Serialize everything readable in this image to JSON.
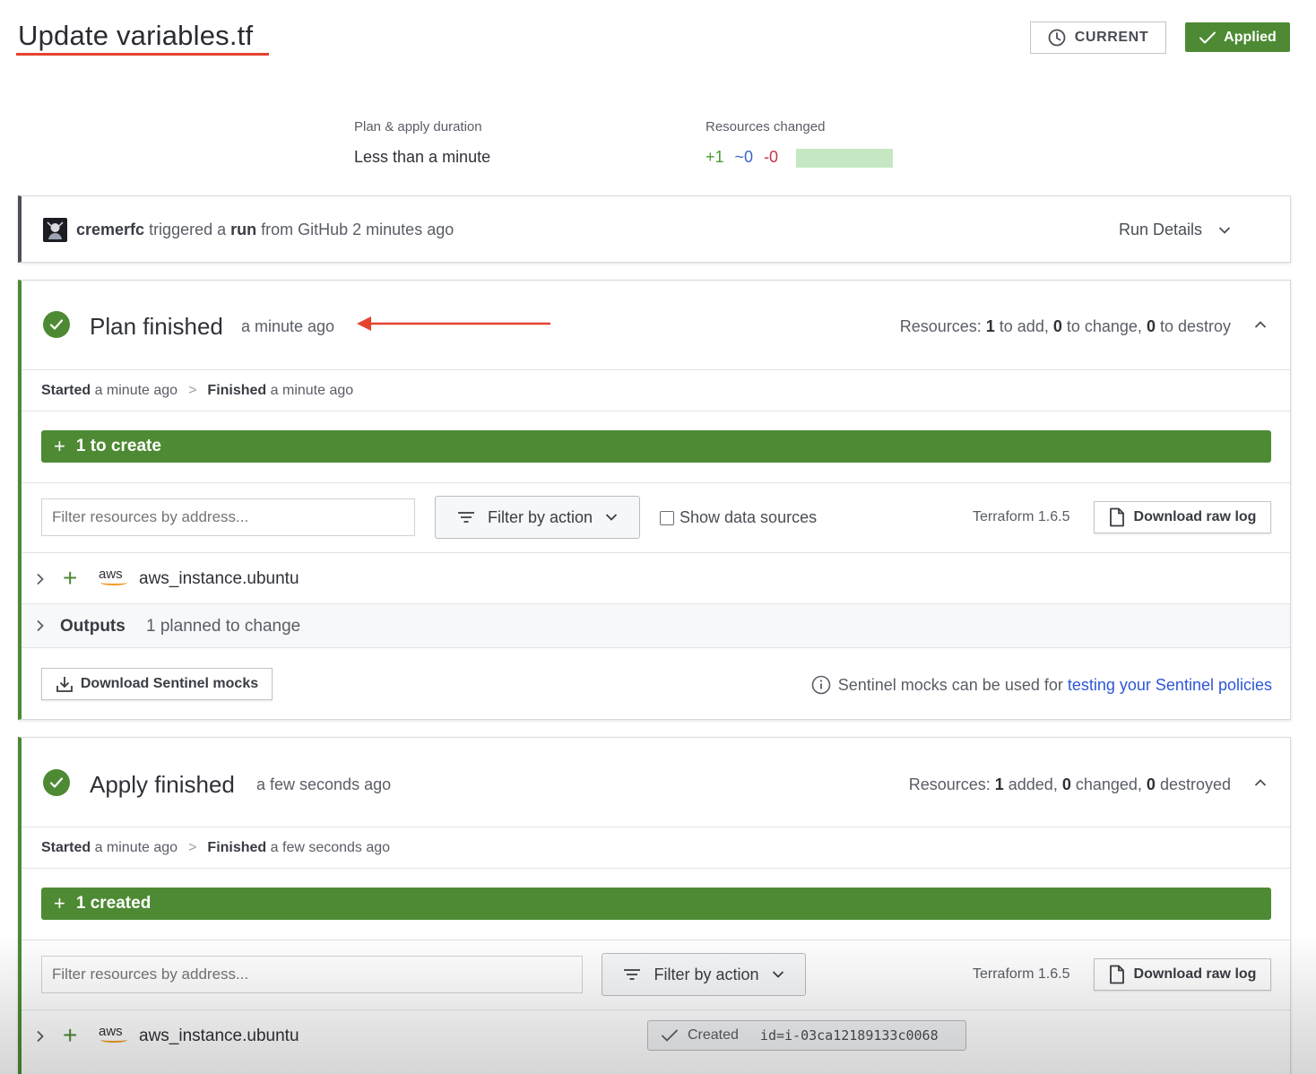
{
  "header": {
    "title": "Update variables.tf",
    "current_label": "CURRENT",
    "applied_label": "Applied"
  },
  "summary": {
    "duration_label": "Plan & apply duration",
    "duration_value": "Less than a minute",
    "resources_label": "Resources changed",
    "added": "+1",
    "changed": "~0",
    "destroyed": "-0"
  },
  "trigger": {
    "user": "cremerfc",
    "text1": " triggered a ",
    "run": "run",
    "text2": " from GitHub 2 minutes ago",
    "run_details": "Run Details"
  },
  "plan": {
    "title": "Plan finished",
    "time": "a minute ago",
    "res_prefix": "Resources: ",
    "res_add": "1",
    "res_add_text": " to add, ",
    "res_change": "0",
    "res_change_text": " to change, ",
    "res_destroy": "0",
    "res_destroy_text": " to destroy",
    "started_label": "Started",
    "started_time": " a minute ago",
    "finished_label": "Finished",
    "finished_time": " a minute ago",
    "bar_label": "1 to create",
    "filter_placeholder": "Filter resources by address...",
    "filter_action": "Filter by action",
    "show_data_sources": "Show data sources",
    "terraform_version": "Terraform 1.6.5",
    "download_raw_log": "Download raw log",
    "resource_provider": "aws",
    "resource_name": "aws_instance.ubuntu",
    "outputs_label": "Outputs",
    "outputs_value": "1 planned to change",
    "sentinel_button": "Download Sentinel mocks",
    "sentinel_note": "Sentinel mocks can be used for ",
    "sentinel_link": "testing your Sentinel policies"
  },
  "apply": {
    "title": "Apply finished",
    "time": "a few seconds ago",
    "res_prefix": "Resources: ",
    "res_add": "1",
    "res_add_text": " added, ",
    "res_change": "0",
    "res_change_text": " changed, ",
    "res_destroy": "0",
    "res_destroy_text": " destroyed",
    "started_label": "Started",
    "started_time": " a minute ago",
    "finished_label": "Finished",
    "finished_time": " a few seconds ago",
    "bar_label": "1 created",
    "filter_placeholder": "Filter resources by address...",
    "filter_action": "Filter by action",
    "terraform_version": "Terraform 1.6.5",
    "download_raw_log": "Download raw log",
    "resource_provider": "aws",
    "resource_name": "aws_instance.ubuntu",
    "created_label": "Created",
    "created_id": "id=i-03ca12189133c0068"
  },
  "colors": {
    "accent_green": "#4d8a33",
    "annotation_red": "#e5422f",
    "link_blue": "#2e56d6"
  }
}
